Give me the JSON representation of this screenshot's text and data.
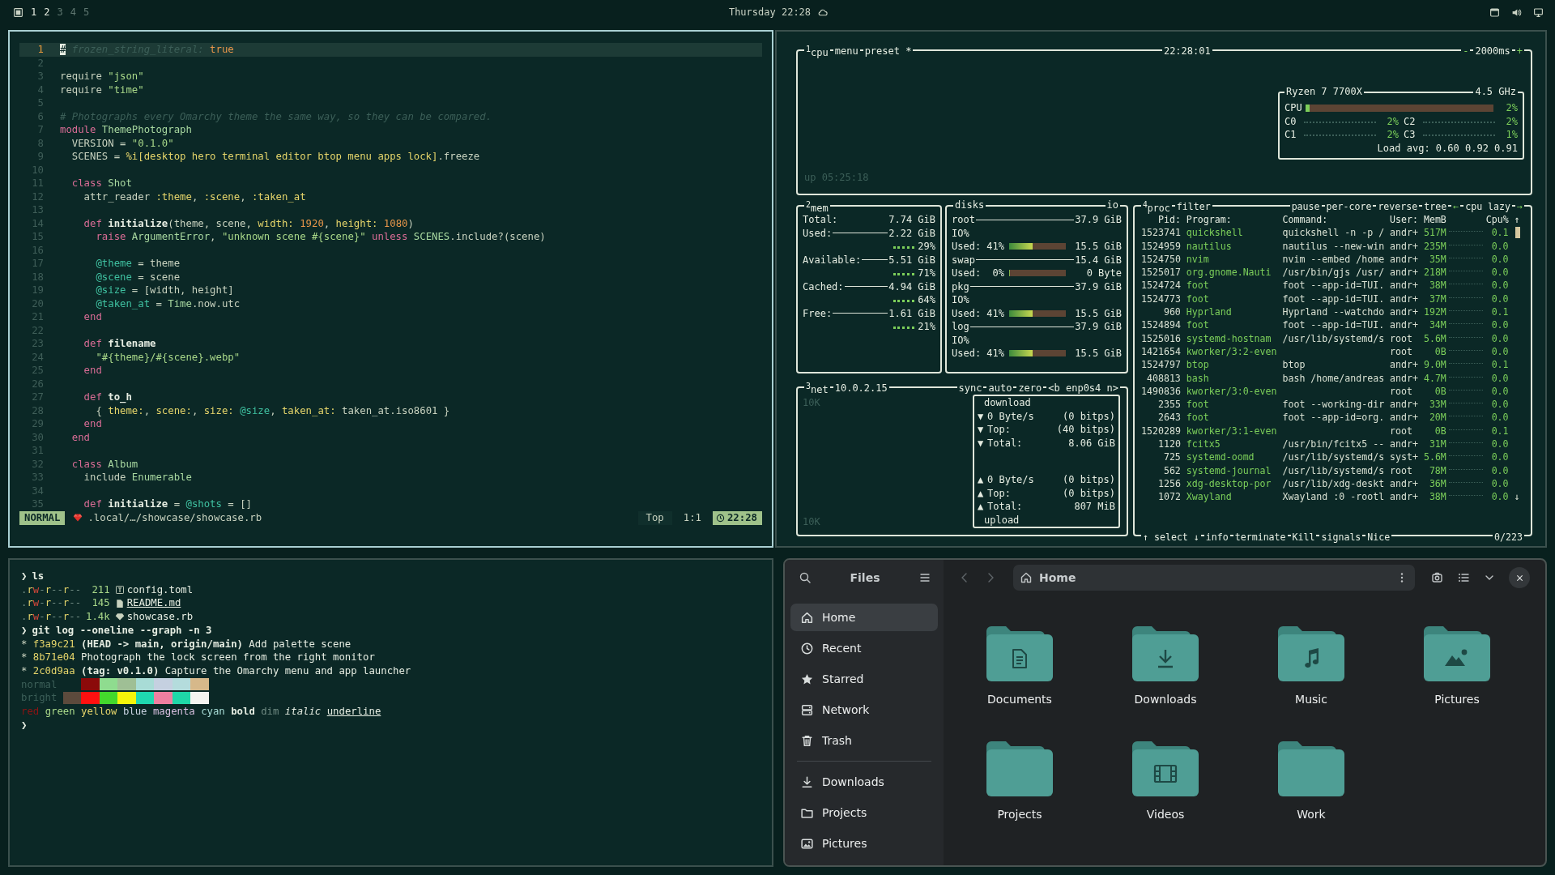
{
  "topbar": {
    "workspaces": [
      {
        "label": "1",
        "occupied": true
      },
      {
        "label": "2",
        "occupied": true
      },
      {
        "label": "3",
        "occupied": false
      },
      {
        "label": "4",
        "occupied": false
      },
      {
        "label": "5",
        "occupied": false
      }
    ],
    "clock": "Thursday 22:28"
  },
  "editor": {
    "lines": [
      {
        "number": "1",
        "current": true,
        "segments": [
          {
            "text": "#",
            "kind": "cursor"
          },
          {
            "text": " frozen_string_literal: ",
            "kind": "com"
          },
          {
            "text": "true",
            "kind": "num"
          }
        ]
      },
      {
        "number": "2",
        "current": false
      },
      {
        "number": "3",
        "current": false,
        "segments": [
          {
            "text": "require ",
            "kind": "plain"
          },
          {
            "text": "\"json\"",
            "kind": "str"
          }
        ]
      },
      {
        "number": "4",
        "current": false,
        "segments": [
          {
            "text": "require ",
            "kind": "plain"
          },
          {
            "text": "\"time\"",
            "kind": "str"
          }
        ]
      },
      {
        "number": "5",
        "current": false
      },
      {
        "number": "6",
        "current": false,
        "segments": [
          {
            "text": "# Photographs every Omarchy theme the same way, so they can be compared.",
            "kind": "com"
          }
        ]
      },
      {
        "number": "7",
        "current": false,
        "segments": [
          {
            "text": "module ",
            "kind": "kw"
          },
          {
            "text": "ThemePhotograph",
            "kind": "const"
          }
        ]
      },
      {
        "number": "8",
        "current": false,
        "segments": [
          {
            "text": "  VERSION = ",
            "kind": "plain"
          },
          {
            "text": "\"0.1.0\"",
            "kind": "str"
          }
        ]
      },
      {
        "number": "9",
        "current": false,
        "segments": [
          {
            "text": "  SCENES = ",
            "kind": "plain"
          },
          {
            "text": "%i[desktop hero terminal editor btop menu apps lock]",
            "kind": "sym"
          },
          {
            "text": ".freeze",
            "kind": "plain"
          }
        ]
      },
      {
        "number": "10",
        "current": false
      },
      {
        "number": "11",
        "current": false,
        "segments": [
          {
            "text": "  class ",
            "kind": "kw"
          },
          {
            "text": "Shot",
            "kind": "const"
          }
        ]
      },
      {
        "number": "12",
        "current": false,
        "segments": [
          {
            "text": "    attr_reader ",
            "kind": "plain"
          },
          {
            "text": ":theme",
            "kind": "sym"
          },
          {
            "text": ", ",
            "kind": "plain"
          },
          {
            "text": ":scene",
            "kind": "sym"
          },
          {
            "text": ", ",
            "kind": "plain"
          },
          {
            "text": ":taken_at",
            "kind": "sym"
          }
        ]
      },
      {
        "number": "13",
        "current": false
      },
      {
        "number": "14",
        "current": false,
        "segments": [
          {
            "text": "    def ",
            "kind": "kw"
          },
          {
            "text": "initialize",
            "kind": "fn"
          },
          {
            "text": "(theme, scene, ",
            "kind": "plain"
          },
          {
            "text": "width: ",
            "kind": "sym"
          },
          {
            "text": "1920",
            "kind": "num"
          },
          {
            "text": ", ",
            "kind": "plain"
          },
          {
            "text": "height: ",
            "kind": "sym"
          },
          {
            "text": "1080",
            "kind": "num"
          },
          {
            "text": ")",
            "kind": "plain"
          }
        ]
      },
      {
        "number": "15",
        "current": false,
        "segments": [
          {
            "text": "      raise ",
            "kind": "kw"
          },
          {
            "text": "ArgumentError",
            "kind": "const"
          },
          {
            "text": ", ",
            "kind": "plain"
          },
          {
            "text": "\"unknown scene #{scene}\"",
            "kind": "str"
          },
          {
            "text": " unless ",
            "kind": "kw"
          },
          {
            "text": "SCENES",
            "kind": "const"
          },
          {
            "text": ".include?(scene)",
            "kind": "plain"
          }
        ]
      },
      {
        "number": "16",
        "current": false
      },
      {
        "number": "17",
        "current": false,
        "segments": [
          {
            "text": "      @theme",
            "kind": "ivar"
          },
          {
            "text": " = theme",
            "kind": "plain"
          }
        ]
      },
      {
        "number": "18",
        "current": false,
        "segments": [
          {
            "text": "      @scene",
            "kind": "ivar"
          },
          {
            "text": " = scene",
            "kind": "plain"
          }
        ]
      },
      {
        "number": "19",
        "current": false,
        "segments": [
          {
            "text": "      @size",
            "kind": "ivar"
          },
          {
            "text": " = [width, height]",
            "kind": "plain"
          }
        ]
      },
      {
        "number": "20",
        "current": false,
        "segments": [
          {
            "text": "      @taken_at",
            "kind": "ivar"
          },
          {
            "text": " = ",
            "kind": "plain"
          },
          {
            "text": "Time",
            "kind": "const"
          },
          {
            "text": ".now.utc",
            "kind": "plain"
          }
        ]
      },
      {
        "number": "21",
        "current": false,
        "segments": [
          {
            "text": "    end",
            "kind": "kw"
          }
        ]
      },
      {
        "number": "22",
        "current": false
      },
      {
        "number": "23",
        "current": false,
        "segments": [
          {
            "text": "    def ",
            "kind": "kw"
          },
          {
            "text": "filename",
            "kind": "fn"
          }
        ]
      },
      {
        "number": "24",
        "current": false,
        "segments": [
          {
            "text": "      \"#{theme}/#{scene}.webp\"",
            "kind": "str"
          }
        ]
      },
      {
        "number": "25",
        "current": false,
        "segments": [
          {
            "text": "    end",
            "kind": "kw"
          }
        ]
      },
      {
        "number": "26",
        "current": false
      },
      {
        "number": "27",
        "current": false,
        "segments": [
          {
            "text": "    def ",
            "kind": "kw"
          },
          {
            "text": "to_h",
            "kind": "fn"
          }
        ]
      },
      {
        "number": "28",
        "current": false,
        "segments": [
          {
            "text": "      { ",
            "kind": "plain"
          },
          {
            "text": "theme:",
            "kind": "sym"
          },
          {
            "text": ", ",
            "kind": "plain"
          },
          {
            "text": "scene:",
            "kind": "sym"
          },
          {
            "text": ", ",
            "kind": "plain"
          },
          {
            "text": "size: ",
            "kind": "sym"
          },
          {
            "text": "@size",
            "kind": "ivar"
          },
          {
            "text": ", ",
            "kind": "plain"
          },
          {
            "text": "taken_at:",
            "kind": "sym"
          },
          {
            "text": " taken_at.iso8601 }",
            "kind": "plain"
          }
        ]
      },
      {
        "number": "29",
        "current": false,
        "segments": [
          {
            "text": "    end",
            "kind": "kw"
          }
        ]
      },
      {
        "number": "30",
        "current": false,
        "segments": [
          {
            "text": "  end",
            "kind": "kw"
          }
        ]
      },
      {
        "number": "31",
        "current": false
      },
      {
        "number": "32",
        "current": false,
        "segments": [
          {
            "text": "  class ",
            "kind": "kw"
          },
          {
            "text": "Album",
            "kind": "const"
          }
        ]
      },
      {
        "number": "33",
        "current": false,
        "segments": [
          {
            "text": "    include ",
            "kind": "plain"
          },
          {
            "text": "Enumerable",
            "kind": "const"
          }
        ]
      },
      {
        "number": "34",
        "current": false
      },
      {
        "number": "35",
        "current": false,
        "segments": [
          {
            "text": "    def ",
            "kind": "kw"
          },
          {
            "text": "initialize",
            "kind": "fn"
          },
          {
            "text": " = ",
            "kind": "plain"
          },
          {
            "text": "@shots",
            "kind": "ivar"
          },
          {
            "text": " = []",
            "kind": "plain"
          }
        ]
      }
    ],
    "status": {
      "mode": "NORMAL",
      "path": ".local/…/showcase/showcase.rb",
      "scroll": "Top",
      "position": "1:1",
      "time": "22:28"
    }
  },
  "btop": {
    "cpu": {
      "number": "1",
      "title": "cpu",
      "buttons": [
        "menu",
        "preset *"
      ],
      "clock": "22:28:01",
      "minus": "-",
      "interval": "2000ms",
      "plus": "+",
      "uptime": "up 05:25:18",
      "model": "Ryzen 7 7700X",
      "freq": "4.5 GHz",
      "total": {
        "label": "CPU",
        "value": "2%",
        "level": 0.02
      },
      "cores": [
        {
          "label": "C0",
          "value": "2%"
        },
        {
          "label": "C2",
          "value": "2%"
        },
        {
          "label": "C1",
          "value": "2%"
        },
        {
          "label": "C3",
          "value": "1%"
        }
      ],
      "load": "Load avg: 0.60 0.92 0.91"
    },
    "mem": {
      "number": "2",
      "title": "mem",
      "rows": [
        {
          "label": "Total:",
          "value": "7.74 GiB"
        },
        {
          "label": "Used:",
          "value": "2.22 GiB",
          "percent": "29%"
        },
        {
          "label": "Available:",
          "value": "5.51 GiB",
          "percent": "71%"
        },
        {
          "label": "Cached:",
          "value": "4.94 GiB",
          "percent": "64%"
        },
        {
          "label": "Free:",
          "value": "1.61 GiB",
          "percent": "21%"
        }
      ]
    },
    "disks": {
      "title": "disks",
      "io": "io",
      "items": [
        {
          "name": "root",
          "size": "37.9 GiB",
          "io": "IO%",
          "used": "Used: 41%",
          "level": 0.41,
          "used_size": "15.5 GiB"
        },
        {
          "name": "swap",
          "size": "15.4 GiB",
          "used": "Used:  0%",
          "level": 0,
          "used_size": "0 Byte"
        },
        {
          "name": "pkg",
          "size": "37.9 GiB",
          "io": "IO%",
          "used": "Used: 41%",
          "level": 0.41,
          "used_size": "15.5 GiB"
        },
        {
          "name": "log",
          "size": "37.9 GiB",
          "io": "IO%",
          "used": "Used: 41%",
          "level": 0.41,
          "used_size": "15.5 GiB"
        }
      ]
    },
    "net": {
      "number": "3",
      "title": "net",
      "address": "10.0.2.15",
      "buttons": [
        "sync",
        "auto",
        "zero"
      ],
      "iface": "<b enp0s4 n>",
      "scale_top": "10K",
      "scale_bottom": "10K",
      "download": {
        "label": "download",
        "rows": [
          {
            "arrow": "▼",
            "label": "0 Byte/s",
            "value": "(0 bitps)"
          },
          {
            "arrow": "▼",
            "label": "Top:",
            "value": "(40 bitps)"
          },
          {
            "arrow": "▼",
            "label": "Total:",
            "value": "8.06 GiB"
          }
        ]
      },
      "upload": {
        "label": "upload",
        "rows": [
          {
            "arrow": "▲",
            "label": "0 Byte/s",
            "value": "(0 bitps)"
          },
          {
            "arrow": "▲",
            "label": "Top:",
            "value": "(0 bitps)"
          },
          {
            "arrow": "▲",
            "label": "Total:",
            "value": "807 MiB"
          }
        ]
      }
    },
    "proc": {
      "number": "4",
      "title": "proc",
      "buttons": [
        "filter",
        "pause",
        "per-core",
        "reverse",
        "tree"
      ],
      "sort_left": "←",
      "sort": "cpu lazy",
      "sort_right": "→",
      "columns": [
        "Pid:",
        "Program:",
        "Command:",
        "User:",
        "MemB",
        "Cpu%"
      ],
      "scroll_up": "↑",
      "scroll_down": "↓",
      "rows": [
        {
          "pid": "1523741",
          "program": "quickshell",
          "command": "quickshell -n -p /",
          "user": "andr+",
          "mem": "517M",
          "cpu": "0.1"
        },
        {
          "pid": "1524959",
          "program": "nautilus",
          "command": "nautilus --new-win",
          "user": "andr+",
          "mem": "235M",
          "cpu": "0.0"
        },
        {
          "pid": "1524750",
          "program": "nvim",
          "command": "nvim --embed /home",
          "user": "andr+",
          "mem": "35M",
          "cpu": "0.0"
        },
        {
          "pid": "1525017",
          "program": "org.gnome.Nauti",
          "command": "/usr/bin/gjs /usr/",
          "user": "andr+",
          "mem": "218M",
          "cpu": "0.0"
        },
        {
          "pid": "1524724",
          "program": "foot",
          "command": "foot --app-id=TUI.",
          "user": "andr+",
          "mem": "38M",
          "cpu": "0.0"
        },
        {
          "pid": "1524773",
          "program": "foot",
          "command": "foot --app-id=TUI.",
          "user": "andr+",
          "mem": "37M",
          "cpu": "0.0"
        },
        {
          "pid": "960",
          "program": "Hyprland",
          "command": "Hyprland --watchdo",
          "user": "andr+",
          "mem": "192M",
          "cpu": "0.1"
        },
        {
          "pid": "1524894",
          "program": "foot",
          "command": "foot --app-id=TUI.",
          "user": "andr+",
          "mem": "34M",
          "cpu": "0.0"
        },
        {
          "pid": "1525016",
          "program": "systemd-hostnam",
          "command": "/usr/lib/systemd/s",
          "user": "root",
          "mem": "5.6M",
          "cpu": "0.0"
        },
        {
          "pid": "1421654",
          "program": "kworker/3:2-even",
          "user": "root",
          "mem": "0B",
          "cpu": "0.0"
        },
        {
          "pid": "1524797",
          "program": "btop",
          "command": "btop",
          "user": "andr+",
          "mem": "9.0M",
          "cpu": "0.1"
        },
        {
          "pid": "408813",
          "program": "bash",
          "command": "bash /home/andreas",
          "user": "andr+",
          "mem": "4.7M",
          "cpu": "0.0"
        },
        {
          "pid": "1490836",
          "program": "kworker/3:0-even",
          "user": "root",
          "mem": "0B",
          "cpu": "0.0"
        },
        {
          "pid": "2355",
          "program": "foot",
          "command": "foot --working-dir",
          "user": "andr+",
          "mem": "33M",
          "cpu": "0.0"
        },
        {
          "pid": "2643",
          "program": "foot",
          "command": "foot --app-id=org.",
          "user": "andr+",
          "mem": "20M",
          "cpu": "0.0"
        },
        {
          "pid": "1520289",
          "program": "kworker/3:1-even",
          "user": "root",
          "mem": "0B",
          "cpu": "0.1"
        },
        {
          "pid": "1120",
          "program": "fcitx5",
          "command": "/usr/bin/fcitx5 --",
          "user": "andr+",
          "mem": "31M",
          "cpu": "0.0"
        },
        {
          "pid": "725",
          "program": "systemd-oomd",
          "command": "/usr/lib/systemd/s",
          "user": "syst+",
          "mem": "5.6M",
          "cpu": "0.0"
        },
        {
          "pid": "562",
          "program": "systemd-journal",
          "command": "/usr/lib/systemd/s",
          "user": "root",
          "mem": "78M",
          "cpu": "0.0"
        },
        {
          "pid": "1256",
          "program": "xdg-desktop-por",
          "command": "/usr/lib/xdg-deskt",
          "user": "andr+",
          "mem": "36M",
          "cpu": "0.0"
        },
        {
          "pid": "1072",
          "program": "Xwayland",
          "command": "Xwayland :0 -rootl",
          "user": "andr+",
          "mem": "38M",
          "cpu": "0.0"
        }
      ],
      "footer": [
        "↑ select ↓",
        "info",
        "terminate",
        "Kill",
        "signals",
        "Nice"
      ],
      "count": "0/223"
    }
  },
  "terminal": {
    "lines": [
      {
        "kind": "prompt",
        "symbol": "❯",
        "command": "ls"
      },
      {
        "kind": "ls",
        "perms": ".rw-r--r--",
        "size": "211",
        "name": "config.toml",
        "underline": false
      },
      {
        "kind": "ls",
        "perms": ".rw-r--r--",
        "size": "145",
        "name": "README.md",
        "underline": true
      },
      {
        "kind": "ls",
        "perms": ".rw-r--r--",
        "size": "1.4k",
        "name": "showcase.rb",
        "underline": false
      },
      {
        "kind": "prompt",
        "symbol": "❯",
        "command": "git log --oneline --graph -n 3"
      },
      {
        "kind": "log",
        "graph": "*",
        "hash": "f3a9c21",
        "refs": "(HEAD -> main, origin/main)",
        "message": "Add palette scene"
      },
      {
        "kind": "log",
        "graph": "*",
        "hash": "8b71e04",
        "message": "Photograph the lock screen from the right monitor"
      },
      {
        "kind": "log",
        "graph": "*",
        "hash": "2c0d9aa",
        "refs": "(tag: v0.1.0)",
        "message": "Capture the Omarchy menu and app launcher"
      },
      {
        "kind": "palette",
        "label": "normal",
        "colors": [
          {
            "color": "#8b0a0a"
          },
          {
            "color": "#8fdc8f"
          },
          {
            "color": "#9fbf95"
          },
          {
            "color": "#a8dcd6"
          },
          {
            "color": "#c5d0e0"
          },
          {
            "color": "#b4dcdc"
          },
          {
            "color": "#d6b88a"
          }
        ]
      },
      {
        "kind": "palette",
        "label": "bright",
        "colors": [
          {
            "color": "#5c4a3c"
          },
          {
            "color": "#ff1010"
          },
          {
            "color": "#44d82c"
          },
          {
            "color": "#f5f50a"
          },
          {
            "color": "#1fd8b0"
          },
          {
            "color": "#ef7fa0"
          },
          {
            "color": "#1fd8a8"
          },
          {
            "color": "#f4f4f0"
          }
        ]
      },
      {
        "kind": "styles",
        "words": [
          "red",
          "green",
          "yellow",
          "blue",
          "magenta",
          "cyan",
          "bold",
          "dim",
          "italic",
          "underline"
        ]
      },
      {
        "kind": "prompt",
        "symbol": "❯"
      }
    ]
  },
  "files": {
    "title": "Files",
    "location": "Home",
    "sidebar": [
      {
        "label": "Home",
        "selected": true
      },
      {
        "label": "Recent",
        "selected": false
      },
      {
        "label": "Starred",
        "selected": false
      },
      {
        "label": "Network",
        "selected": false
      },
      {
        "label": "Trash",
        "selected": false
      }
    ],
    "places": [
      "Downloads",
      "Projects",
      "Pictures"
    ],
    "folders": [
      "Documents",
      "Downloads",
      "Music",
      "Pictures",
      "Projects",
      "Videos",
      "Work"
    ]
  }
}
